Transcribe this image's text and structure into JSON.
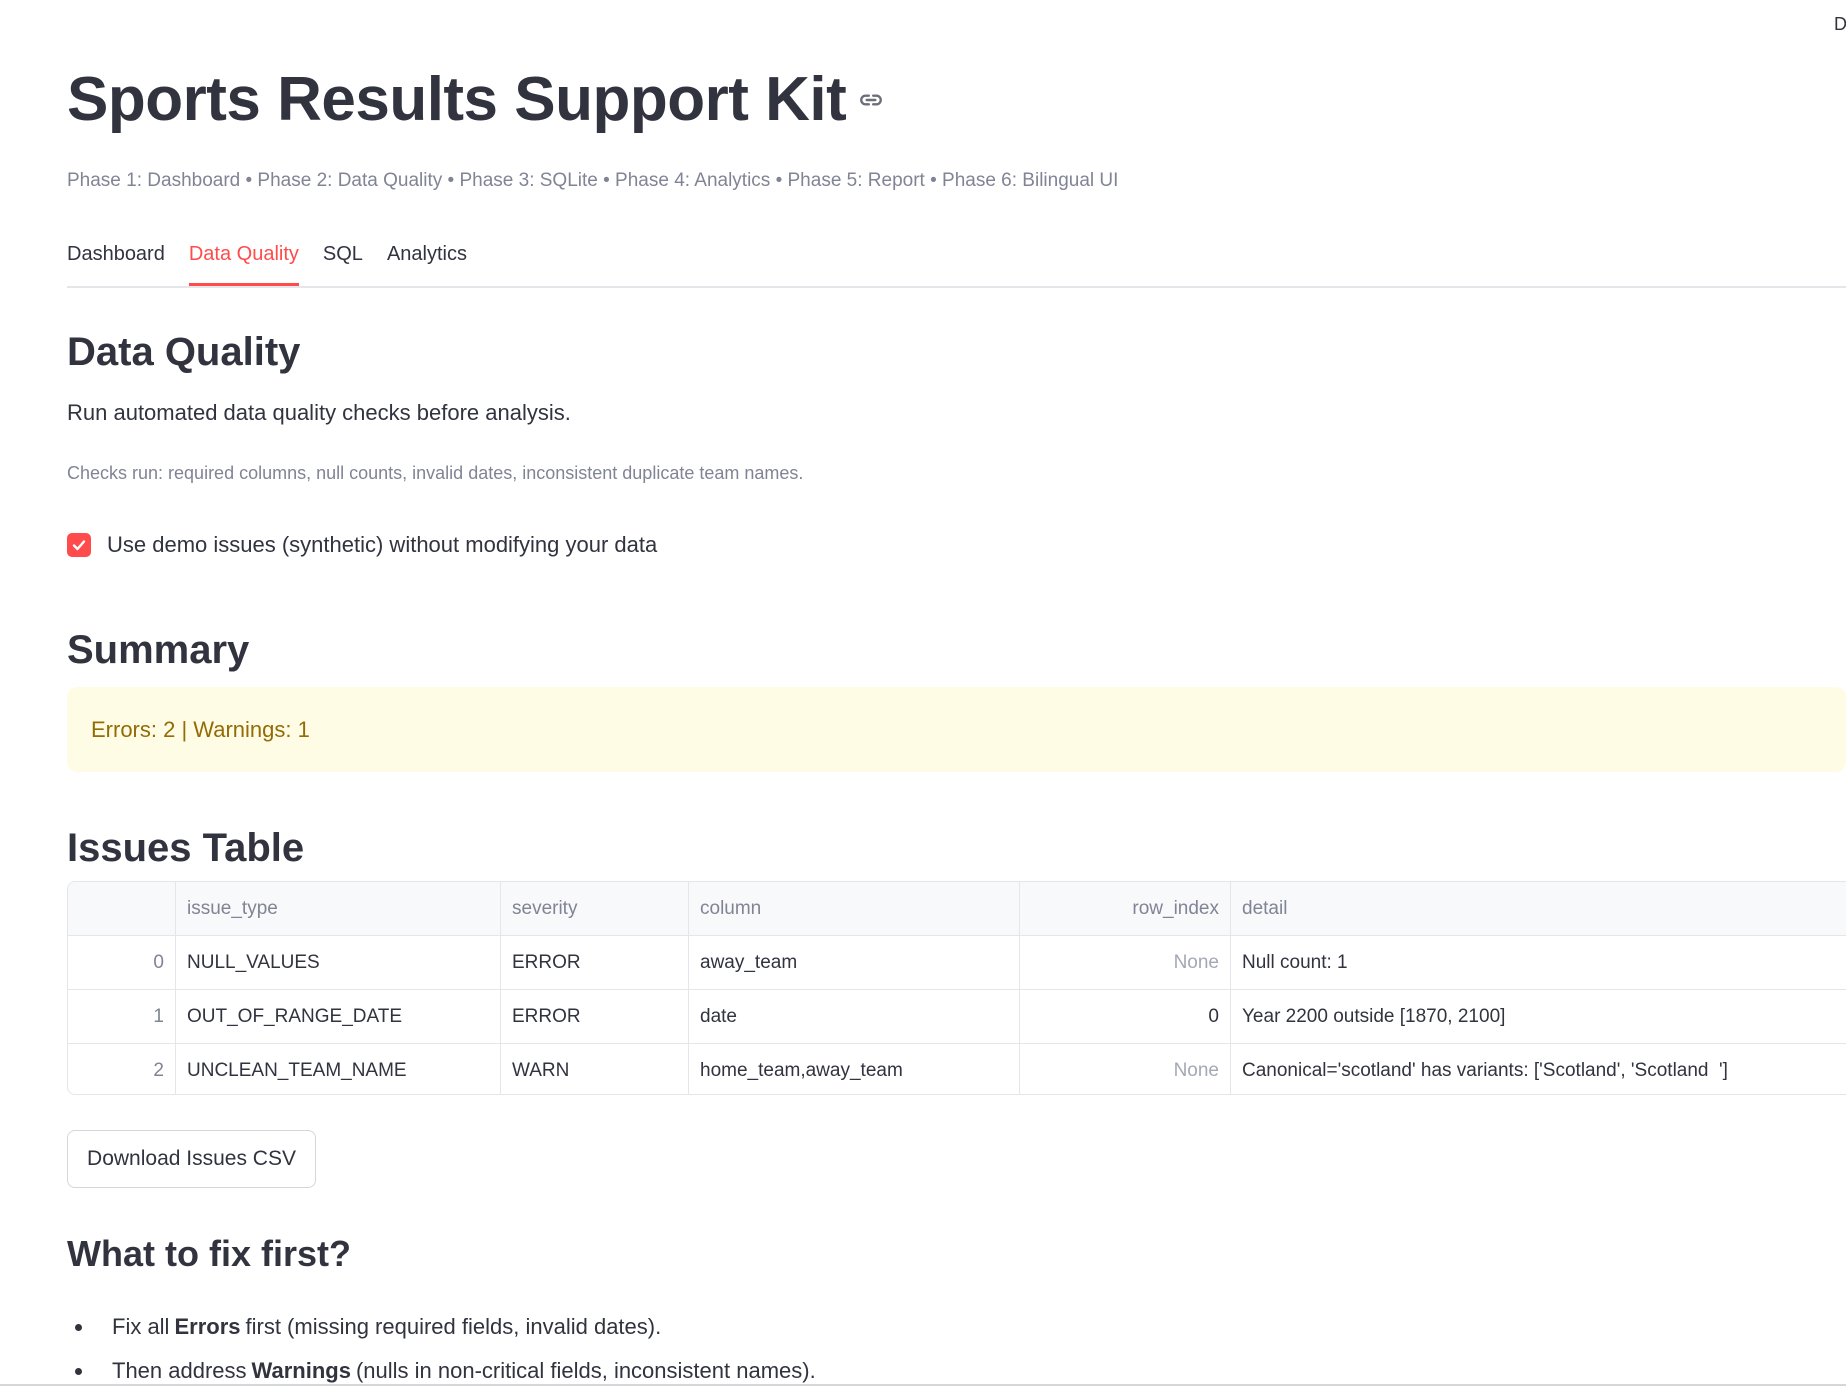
{
  "corner": "D",
  "header": {
    "title": "Sports Results Support Kit",
    "phases": "Phase 1: Dashboard • Phase 2: Data Quality • Phase 3: SQLite • Phase 4: Analytics • Phase 5: Report • Phase 6: Bilingual UI"
  },
  "tabs": [
    {
      "label": "Dashboard",
      "active": false
    },
    {
      "label": "Data Quality",
      "active": true
    },
    {
      "label": "SQL",
      "active": false
    },
    {
      "label": "Analytics",
      "active": false
    }
  ],
  "section": {
    "heading": "Data Quality",
    "description": "Run automated data quality checks before analysis.",
    "caption": "Checks run: required columns, null counts, invalid dates, inconsistent duplicate team names.",
    "checkbox_label": "Use demo issues (synthetic) without modifying your data",
    "checkbox_checked": true
  },
  "summary": {
    "heading": "Summary",
    "alert": "Errors: 2 | Warnings: 1"
  },
  "issues": {
    "heading": "Issues Table",
    "columns": [
      "",
      "issue_type",
      "severity",
      "column",
      "row_index",
      "detail"
    ],
    "rows": [
      {
        "index": "0",
        "issue_type": "NULL_VALUES",
        "severity": "ERROR",
        "column": "away_team",
        "row_index": "None",
        "detail": "Null count: 1"
      },
      {
        "index": "1",
        "issue_type": "OUT_OF_RANGE_DATE",
        "severity": "ERROR",
        "column": "date",
        "row_index": "0",
        "detail": "Year 2200 outside [1870, 2100]"
      },
      {
        "index": "2",
        "issue_type": "UNCLEAN_TEAM_NAME",
        "severity": "WARN",
        "column": "home_team,away_team",
        "row_index": "None",
        "detail": "Canonical='scotland' has variants: ['Scotland', 'Scotland  ']"
      }
    ],
    "download_label": "Download Issues CSV"
  },
  "fix_first": {
    "heading": "What to fix first?",
    "items": [
      {
        "pre": "Fix all",
        "bold": "Errors",
        "post": "first (missing required fields, invalid dates)."
      },
      {
        "pre": "Then address",
        "bold": "Warnings",
        "post": "(nulls in non-critical fields, inconsistent names)."
      }
    ]
  },
  "colors": {
    "accent": "#ff4b4b",
    "warning_bg": "#fffce6",
    "warning_text": "#926c05"
  }
}
